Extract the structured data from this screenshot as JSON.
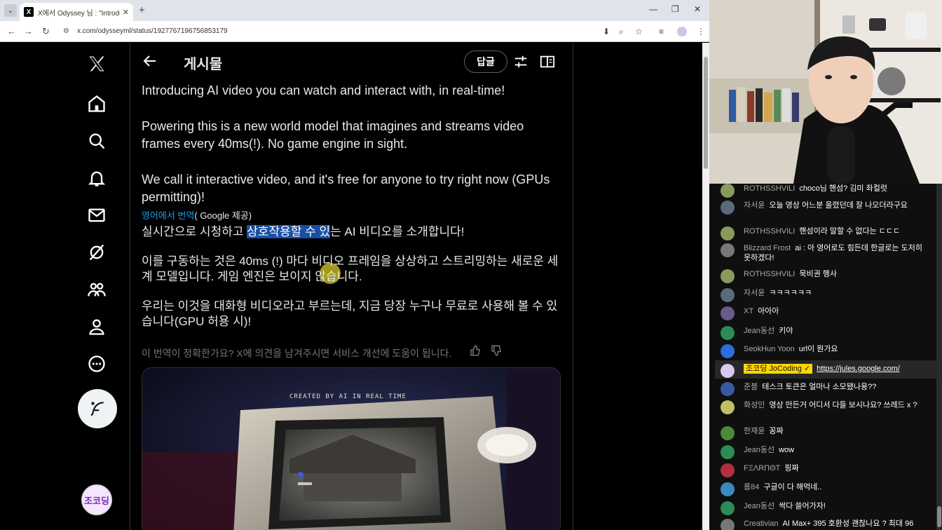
{
  "browser": {
    "tab": {
      "favicon": "X",
      "title": "X에서 Odyssey 님 : \"Introducing",
      "close": "✕"
    },
    "new_tab": "+",
    "window_controls": {
      "minimize": "—",
      "restore": "❐",
      "close": "✕"
    },
    "url": "x.com/odysseyml/status/1927767196756853179"
  },
  "post": {
    "header_title": "게시물",
    "reply_label": "답글",
    "en_p1": "Introducing AI video you can watch and interact with, in real-time!",
    "en_p2": "Powering this is a new world model that imagines and streams video frames every 40ms(!). No game engine in sight.",
    "en_p3": "We call it interactive video, and it's free for anyone to try right now (GPUs permitting)!",
    "translated_from": "영어에서 번역",
    "translated_by": "( Google 제공)",
    "ko_p1_before": "실시간으로 시청하고 ",
    "ko_p1_selected": "상호작용할 수 있",
    "ko_p1_after": "는 AI 비디오를 소개합니다!",
    "ko_p2": "이를 구동하는 것은 40ms (!) 마다 비디오 프레임을 상상하고 스트리밍하는 새로운 세계 모델입니다. 게임 엔진은 보이지 않습니다.",
    "ko_p3": "우리는 이것을 대화형 비디오라고 부르는데, 지금 당장 누구나 무료로 사용해 볼 수 있습니다(GPU 허용 시)!",
    "feedback": "이 번역이 정확한가요? X에 의견을 남겨주시면 서비스 개선에 도움이 됩니다.",
    "media_caption": "CREATED BY AI IN REAL TIME"
  },
  "sidebar": {
    "icons": [
      "x-logo-icon",
      "home-icon",
      "search-icon",
      "notifications-icon",
      "messages-icon",
      "grok-icon",
      "communities-icon",
      "profile-icon",
      "more-icon"
    ],
    "avatar_label": "조코딩"
  },
  "chat": {
    "messages": [
      {
        "author": "ROTHSSHVILI",
        "text": "choco님 핸섬? 김미 좌컬럿",
        "color": "#8a9a5b"
      },
      {
        "author": "자서윤",
        "text": "오늘 영상 어느분 올렸던데 잘 나오더라구요",
        "color": "#5a6a7a"
      },
      {
        "author": "ROTHSSHVILI",
        "text": "핸섬이라 말할 수 없다는 ㄷㄷㄷ",
        "color": "#8a9a5b"
      },
      {
        "author": "Blizzard Frost",
        "text": "ai : 아 영어로도 힘든데 한글로는 도저히 못하겠다!",
        "color": "#777777"
      },
      {
        "author": "ROTHSSHVILI",
        "text": "묵비권 행사",
        "color": "#8a9a5b"
      },
      {
        "author": "자서윤",
        "text": "ㅋㅋㅋㅋㅋㅋ",
        "color": "#5a6a7a"
      },
      {
        "author": "XT",
        "text": "아아아",
        "color": "#6a5a8a"
      },
      {
        "author": "Jean동선",
        "text": "키야",
        "color": "#2e8b57"
      },
      {
        "author": "SeokHun Yoon",
        "text": "url이 뭔가요",
        "color": "#2a6fdb"
      },
      {
        "author": "조코딩 JoCoding ✓",
        "text": "https://jules.google.com/",
        "color": "#d8c8f0"
      },
      {
        "author": "준블",
        "text": "테스크 토큰은 얼마나 소모됐나용??",
        "color": "#3a5aa0"
      },
      {
        "author": "화성인",
        "text": "영상 만든거 어디서 다들 보시나요? 쓰레드 x ?",
        "color": "#c0c060"
      },
      {
        "author": "한재윤",
        "text": "꽁짜",
        "color": "#4a8a3a"
      },
      {
        "author": "Jean동선",
        "text": "wow",
        "color": "#2e8b57"
      },
      {
        "author": "FΞΛRΠΘT",
        "text": "핑짜",
        "color": "#b03040"
      },
      {
        "author": "롬84",
        "text": "구글이 다 해먹네..",
        "color": "#3a8ac0"
      },
      {
        "author": "Jean동선",
        "text": "싹다 쓸어가자!",
        "color": "#2e8b57"
      },
      {
        "author": "Creativian",
        "text": "AI Max+ 395 호환성 괜찮나요 ? 최대 96",
        "color": "#777777"
      }
    ]
  }
}
